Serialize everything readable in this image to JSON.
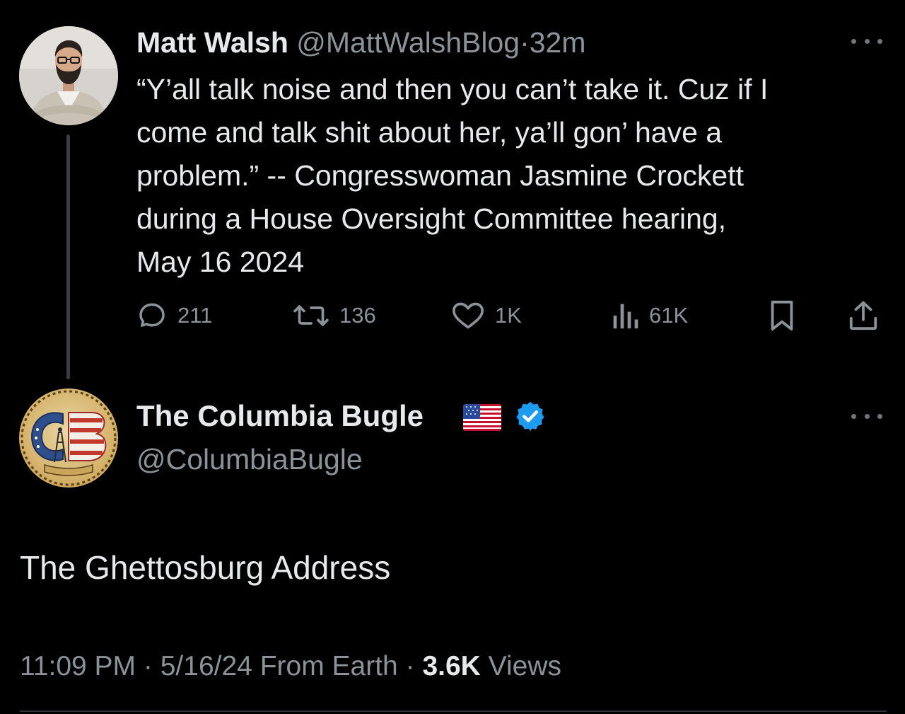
{
  "parent_tweet": {
    "author_name": "Matt Walsh",
    "author_handle": "@MattWalshBlog",
    "separator": "·",
    "time": "32m",
    "text": "“Y’all talk noise and then you can’t take it. Cuz if I\ncome and talk shit about her, ya’ll gon’ have a\nproblem.” -- Congresswoman Jasmine Crockett\nduring a House Oversight Committee hearing,\nMay 16 2024",
    "actions": {
      "replies": "211",
      "reposts": "136",
      "likes": "1K",
      "views": "61K"
    }
  },
  "main_tweet": {
    "author_name": "The Columbia Bugle",
    "author_flag_icon": "us-flag-emoji",
    "verified_color": "#1d9bf0",
    "author_handle": "@ColumbiaBugle",
    "text": "The Ghettosburg Address",
    "meta": {
      "time": "11:09 PM",
      "separator": "·",
      "date": "5/16/24",
      "source": "From Earth",
      "views_count": "3.6K",
      "views_label": "Views"
    }
  },
  "colors": {
    "background": "#000000",
    "primary_text": "#e7e9ea",
    "secondary_text": "#8b9298",
    "accent_blue": "#1d9bf0"
  }
}
